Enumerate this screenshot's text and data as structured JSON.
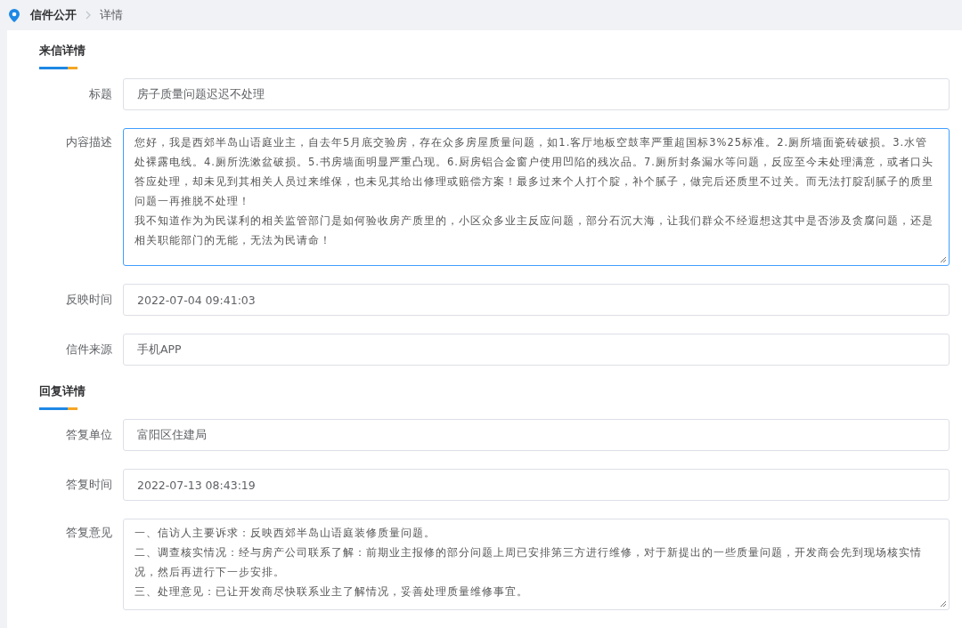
{
  "breadcrumb": {
    "items": [
      "信件公开",
      "详情"
    ]
  },
  "sections": [
    {
      "title": "来信详情",
      "fields": [
        {
          "label": "标题",
          "kind": "input",
          "value": "房子质量问题迟迟不处理",
          "focused": false
        },
        {
          "label": "内容描述",
          "kind": "textarea",
          "focused": true,
          "paragraphs": [
            "您好，我是西郊半岛山语庭业主，自去年5月底交验房，存在众多房屋质量问题，如1.客厅地板空鼓率严重超国标3%25标准。2.厕所墙面瓷砖破损。3.水管处裸露电线。4.厕所洗漱盆破损。5.书房墙面明显严重凸现。6.厨房铝合金窗户使用凹陷的残次品。7.厕所封条漏水等问题，反应至今未处理满意，或者口头答应处理，却未见到其相关人员过来维保，也未见其给出修理或赔偿方案！最多过来个人打个腚，补个腻子，做完后还质里不过关。而无法打腚刮腻子的质里问题一再推脱不处理！",
            "我不知道作为为民谋利的相关监管部门是如何验收房产质里的，小区众多业主反应问题，部分石沉大海，让我们群众不经遐想这其中是否涉及贪腐问题，还是相关职能部门的无能，无法为民请命！"
          ]
        },
        {
          "label": "反映时间",
          "kind": "input",
          "value": "2022-07-04 09:41:03",
          "focused": false
        },
        {
          "label": "信件来源",
          "kind": "input",
          "value": "手机APP",
          "focused": false
        }
      ]
    },
    {
      "title": "回复详情",
      "fields": [
        {
          "label": "答复单位",
          "kind": "input",
          "value": "富阳区住建局",
          "focused": false
        },
        {
          "label": "答复时间",
          "kind": "input",
          "value": "2022-07-13 08:43:19",
          "focused": false
        },
        {
          "label": "答复意见",
          "kind": "textarea",
          "focused": false,
          "paragraphs": [
            "一、信访人主要诉求：反映西郊半岛山语庭装修质量问题。",
            "二、调查核实情况：经与房产公司联系了解：前期业主报修的部分问题上周已安排第三方进行维修，对于新提出的一些质量问题，开发商会先到现场核实情况，然后再进行下一步安排。",
            "三、处理意见：已让开发商尽快联系业主了解情况，妥善处理质量维修事宜。"
          ]
        }
      ]
    }
  ]
}
